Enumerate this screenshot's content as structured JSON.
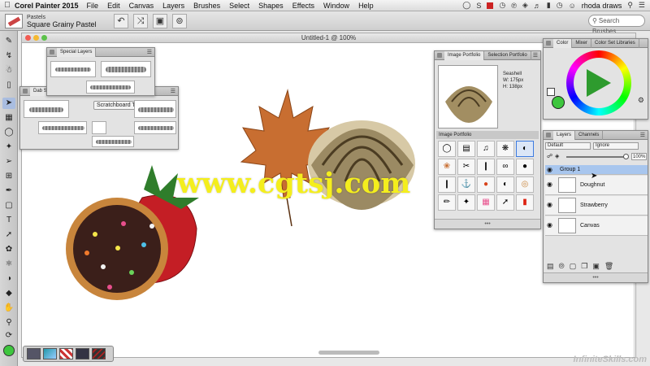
{
  "menubar": {
    "app_name": "Corel Painter 2015",
    "items": [
      "File",
      "Edit",
      "Canvas",
      "Layers",
      "Brushes",
      "Select",
      "Shapes",
      "Effects",
      "Window",
      "Help"
    ],
    "user": "rhoda draws"
  },
  "propbar": {
    "brush_category": "Pastels",
    "brush_variant": "Square Grainy Pastel",
    "search_placeholder": "Search Brushes"
  },
  "canvas": {
    "title": "Untitled-1 @ 100%"
  },
  "dab_panels": {
    "top_tab": "Special Layers",
    "back_tab": "Dab Sh...",
    "scratch_label": "Scratchboard Tool"
  },
  "portfolio": {
    "tabs": [
      "Image Portfolio",
      "Selection Portfolio"
    ],
    "item_name": "Seashell",
    "width": "W: 175px",
    "height": "H: 138px",
    "subheader": "Image Portfolio"
  },
  "color_panel": {
    "tabs": [
      "Color",
      "Mixer",
      "Color Set Libraries"
    ],
    "accent": "#3ec63e"
  },
  "layers": {
    "tabs": [
      "Layers",
      "Channels"
    ],
    "composite_method": "Default",
    "preserve": "Ignore",
    "opacity": "100%",
    "opacity_value": 1.0,
    "rows": [
      {
        "name": "Group 1",
        "type": "group"
      },
      {
        "name": "Doughnut",
        "type": "layer"
      },
      {
        "name": "Strawberry",
        "type": "layer"
      },
      {
        "name": "Canvas",
        "type": "canvas"
      }
    ]
  },
  "watermark": "www.cgtsj.com",
  "brand": "InfiniteSkills.com"
}
